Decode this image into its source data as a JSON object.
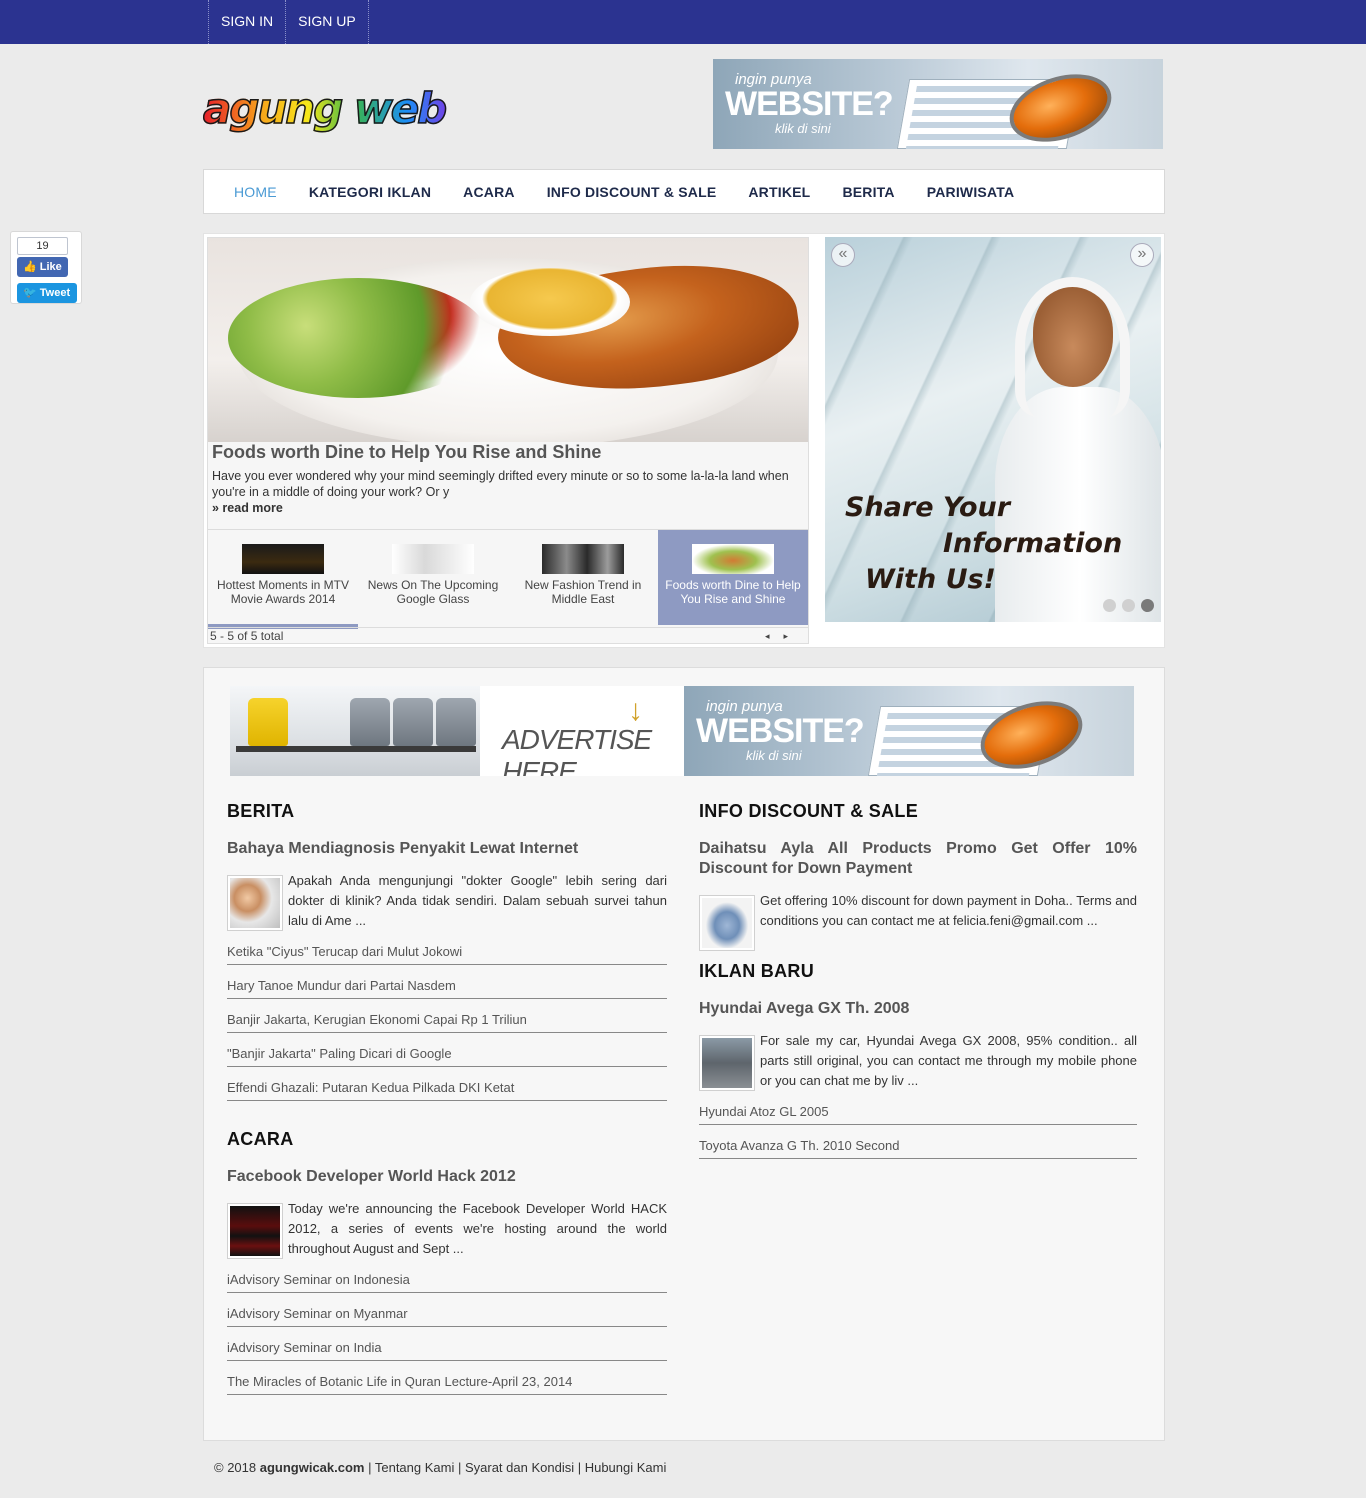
{
  "topbar": {
    "sign_in": "SIGN IN",
    "sign_up": "SIGN UP",
    "color": "#2b3390"
  },
  "logo": {
    "text": "agung web"
  },
  "banner_website": {
    "small": "ingin punya",
    "big": "WEBSITE?",
    "sub": "klik di sini"
  },
  "nav": {
    "items": [
      "HOME",
      "KATEGORI IKLAN",
      "ACARA",
      "INFO DISCOUNT & SALE",
      "ARTIKEL",
      "BERITA",
      "PARIWISATA"
    ],
    "active_color": "#4a9ad4"
  },
  "social": {
    "count": "19",
    "like": "Like",
    "tweet": "Tweet"
  },
  "featured": {
    "title": "Foods worth Dine to Help You Rise and Shine",
    "desc": "Have you ever wondered why your mind seemingly drifted every minute or so to some la-la-la land when you're in a middle of doing your work? Or y",
    "more": "» read more",
    "thumbs": [
      "Hottest Moments in MTV Movie Awards 2014",
      "News On The Upcoming Google Glass",
      "New Fashion Trend in Middle East",
      "Foods worth Dine to Help You Rise and Shine"
    ],
    "pager": "5 - 5 of 5 total",
    "prev": "◂",
    "next": "▸"
  },
  "promo": {
    "line1": "Share Your",
    "line2": "Information",
    "line3": "With Us!",
    "prev": "«",
    "next": "»"
  },
  "ads": {
    "advertise": "ADVERTISE HERE",
    "arrow": "↓"
  },
  "berita": {
    "heading": "BERITA",
    "top_title": "Bahaya Mendiagnosis Penyakit Lewat Internet",
    "top_text": "Apakah Anda mengunjungi \"dokter Google\" lebih sering dari dokter di klinik? Anda tidak sendiri. Dalam sebuah survei tahun lalu di Ame ...",
    "links": [
      "Ketika \"Ciyus\" Terucap dari Mulut Jokowi",
      "Hary Tanoe Mundur dari Partai Nasdem",
      "Banjir Jakarta, Kerugian Ekonomi Capai Rp 1 Triliun",
      "\"Banjir Jakarta\" Paling Dicari di Google",
      "Effendi Ghazali: Putaran Kedua Pilkada DKI Ketat"
    ]
  },
  "acara": {
    "heading": "ACARA",
    "top_title": "Facebook Developer World Hack 2012",
    "top_text": "Today we're announcing the Facebook Developer World HACK 2012, a series of events we're hosting around the world throughout August and Sept ...",
    "links": [
      "iAdvisory Seminar on Indonesia",
      "iAdvisory Seminar on Myanmar",
      "iAdvisory Seminar on India",
      "The Miracles of Botanic Life in Quran Lecture-April 23, 2014"
    ]
  },
  "discount": {
    "heading": "INFO DISCOUNT & SALE",
    "top_title": "Daihatsu Ayla All Products Promo Get Offer 10% Discount for Down Payment",
    "top_text": "Get offering 10% discount for down payment in Doha.. Terms and conditions you can contact me at felicia.feni@gmail.com ..."
  },
  "iklan": {
    "heading": "IKLAN BARU",
    "top_title": "Hyundai Avega GX Th. 2008",
    "top_text": "For sale my car, Hyundai Avega GX 2008, 95% condition.. all parts still original, you can contact me through my mobile phone or you can chat me by liv ...",
    "links": [
      "Hyundai Atoz GL 2005",
      "Toyota Avanza G Th. 2010 Second"
    ]
  },
  "footer": {
    "copyright": "© 2018 ",
    "site": "agungwicak.com",
    "sep": " | ",
    "about": "Tentang Kami",
    "terms": "Syarat dan Kondisi",
    "contact": "Hubungi Kami"
  }
}
